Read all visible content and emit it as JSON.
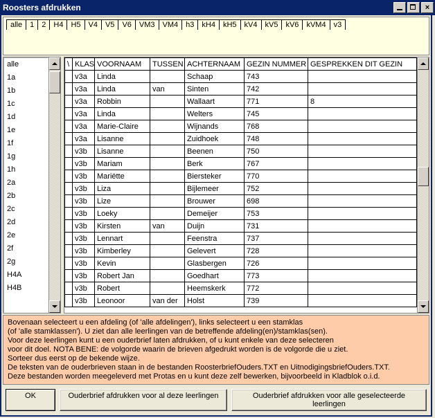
{
  "window": {
    "title": "Roosters afdrukken"
  },
  "tabs": [
    "alle",
    "1",
    "2",
    "H4",
    "H5",
    "V4",
    "V5",
    "V6",
    "VM3",
    "VM4",
    "h3",
    "kH4",
    "kH5",
    "kV4",
    "kV5",
    "kV6",
    "kVM4",
    "v3"
  ],
  "active_tab_index": 0,
  "left_list": [
    "alle",
    "1a",
    "1b",
    "1c",
    "1d",
    "1e",
    "1f",
    "1g",
    "1h",
    "2a",
    "2b",
    "2c",
    "2d",
    "2e",
    "2f",
    "2g",
    "H4A",
    "H4B"
  ],
  "table": {
    "headers": [
      "\\",
      "KLAS",
      "VOORNAAM",
      "TUSSEN",
      "ACHTERNAAM",
      "GEZIN NUMMER",
      "GESPREKKEN DIT GEZIN"
    ],
    "rows": [
      {
        "klas": "v3a",
        "voor": "Linda",
        "tus": "",
        "ach": "Schaap",
        "gez": "743",
        "ges": ""
      },
      {
        "klas": "v3a",
        "voor": "Linda",
        "tus": "van",
        "ach": "Sinten",
        "gez": "742",
        "ges": ""
      },
      {
        "klas": "v3a",
        "voor": "Robbin",
        "tus": "",
        "ach": "Wallaart",
        "gez": "771",
        "ges": "8"
      },
      {
        "klas": "v3a",
        "voor": "Linda",
        "tus": "",
        "ach": "Welters",
        "gez": "745",
        "ges": ""
      },
      {
        "klas": "v3a",
        "voor": "Marie-Claire",
        "tus": "",
        "ach": "Wijnands",
        "gez": "768",
        "ges": ""
      },
      {
        "klas": "v3a",
        "voor": "Lisanne",
        "tus": "",
        "ach": "Zuidhoek",
        "gez": "748",
        "ges": ""
      },
      {
        "klas": "v3b",
        "voor": "Lisanne",
        "tus": "",
        "ach": "Beenen",
        "gez": "750",
        "ges": ""
      },
      {
        "klas": "v3b",
        "voor": "Mariam",
        "tus": "",
        "ach": "Berk",
        "gez": "767",
        "ges": ""
      },
      {
        "klas": "v3b",
        "voor": "Mariëtte",
        "tus": "",
        "ach": "Biersteker",
        "gez": "770",
        "ges": ""
      },
      {
        "klas": "v3b",
        "voor": "Liza",
        "tus": "",
        "ach": "Bijlemeer",
        "gez": "752",
        "ges": ""
      },
      {
        "klas": "v3b",
        "voor": "Lize",
        "tus": "",
        "ach": "Brouwer",
        "gez": "698",
        "ges": ""
      },
      {
        "klas": "v3b",
        "voor": "Loeky",
        "tus": "",
        "ach": "Demeijer",
        "gez": "753",
        "ges": ""
      },
      {
        "klas": "v3b",
        "voor": "Kirsten",
        "tus": "van",
        "ach": "Duijn",
        "gez": "731",
        "ges": ""
      },
      {
        "klas": "v3b",
        "voor": "Lennart",
        "tus": "",
        "ach": "Feenstra",
        "gez": "737",
        "ges": ""
      },
      {
        "klas": "v3b",
        "voor": "Kimberley",
        "tus": "",
        "ach": "Gelevert",
        "gez": "728",
        "ges": ""
      },
      {
        "klas": "v3b",
        "voor": "Kevin",
        "tus": "",
        "ach": "Glasbergen",
        "gez": "726",
        "ges": ""
      },
      {
        "klas": "v3b",
        "voor": "Robert Jan",
        "tus": "",
        "ach": "Goedhart",
        "gez": "773",
        "ges": ""
      },
      {
        "klas": "v3b",
        "voor": "Robert",
        "tus": "",
        "ach": "Heemskerk",
        "gez": "772",
        "ges": ""
      },
      {
        "klas": "v3b",
        "voor": "Leonoor",
        "tus": "van der",
        "ach": "Holst",
        "gez": "739",
        "ges": ""
      }
    ]
  },
  "info": {
    "l1": "Bovenaan selecteert u een afdeling (of 'alle afdelingen'), links selecteert u een stamklas",
    "l2": "(of 'alle stamklassen'). U ziet dan alle leerlingen van de betreffende afdeling(en)/stamklas(sen).",
    "l3": "Voor deze leerlingen kunt u een ouderbrief laten afdrukken, of u kunt enkele van deze selecteren",
    "l4": "voor dit doel. NOTA BENE: de volgorde waarin de brieven afgedrukt worden is de volgorde die u ziet.",
    "l5": "Sorteer dus eerst op de bekende wijze.",
    "l6": "De teksten van de ouderbrieven staan in de bestanden RoosterbriefOuders.TXT en UitnodigingsbriefOuders.TXT.",
    "l7": "Deze bestanden worden meegeleverd met Protas en u kunt deze zelf bewerken, bijvoorbeeld in Kladblok o.i.d."
  },
  "buttons": {
    "ok": "OK",
    "mid": "Ouderbrief afdrukken voor al deze leerlingen",
    "right": "Ouderbrief afdrukken voor alle geselecteerde leerlingen"
  }
}
